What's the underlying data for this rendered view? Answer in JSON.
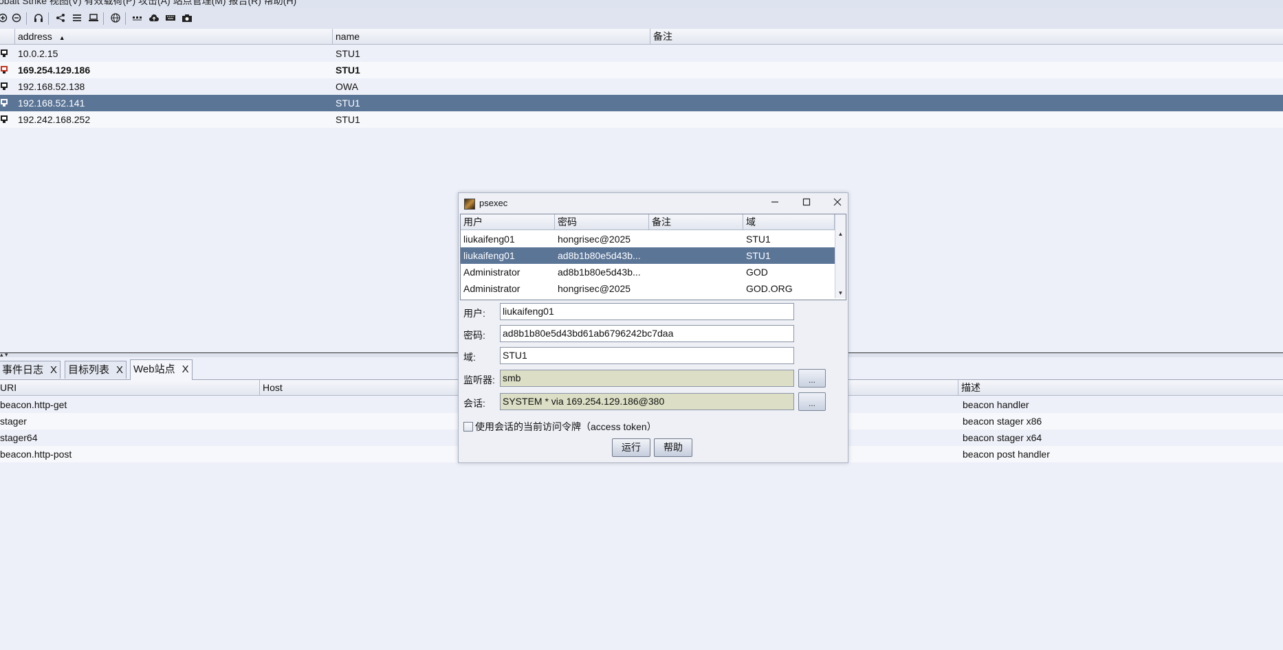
{
  "app": {
    "menu_text": "obalt Strike  视图(V)  有效载荷(P)  攻击(A)  站点管理(M)  报告(R)  帮助(H)"
  },
  "toolbar": {
    "icons": [
      "plus-circle-icon",
      "minus-circle-icon",
      "headphones-icon",
      "share-icon",
      "list-icon",
      "laptop-icon",
      "globe-icon",
      "dots-icon",
      "cloud-icon",
      "keyboard-icon",
      "camera-icon"
    ]
  },
  "targets": {
    "columns": [
      "address",
      "name",
      "备注"
    ],
    "sort_indicator": "▲",
    "rows": [
      {
        "address": "10.0.2.15",
        "name": "STU1",
        "note": ""
      },
      {
        "address": "169.254.129.186",
        "name": "STU1",
        "note": ""
      },
      {
        "address": "192.168.52.138",
        "name": "OWA",
        "note": ""
      },
      {
        "address": "192.168.52.141",
        "name": "STU1",
        "note": ""
      },
      {
        "address": "192.242.168.252",
        "name": "STU1",
        "note": ""
      }
    ]
  },
  "tabs": [
    {
      "label": "事件日志",
      "close": "X"
    },
    {
      "label": "目标列表",
      "close": "X"
    },
    {
      "label": "Web站点",
      "close": "X"
    }
  ],
  "sites": {
    "columns": [
      "URI",
      "Host",
      "描述"
    ],
    "rows": [
      {
        "uri": "beacon.http-get",
        "desc": "beacon handler"
      },
      {
        "uri": "stager",
        "desc": "beacon stager x86"
      },
      {
        "uri": "stager64",
        "desc": "beacon stager x64"
      },
      {
        "uri": "beacon.http-post",
        "desc": "beacon post handler"
      }
    ]
  },
  "dialog": {
    "title": "psexec",
    "cred_columns": [
      "用户",
      "密码",
      "备注",
      "域"
    ],
    "creds": [
      {
        "user": "liukaifeng01",
        "password": "hongrisec@2025",
        "note": "",
        "domain": "STU1"
      },
      {
        "user": "liukaifeng01",
        "password": "ad8b1b80e5d43b...",
        "note": "",
        "domain": "STU1"
      },
      {
        "user": "Administrator",
        "password": "ad8b1b80e5d43b...",
        "note": "",
        "domain": "GOD"
      },
      {
        "user": "Administrator",
        "password": "hongrisec@2025",
        "note": "",
        "domain": "GOD.ORG"
      }
    ],
    "labels": {
      "user": "用户:",
      "password": "密码:",
      "domain": "域:",
      "listener": "监听器:",
      "session": "会话:"
    },
    "values": {
      "user": "liukaifeng01",
      "password": "ad8b1b80e5d43bd61ab6796242bc7daa",
      "domain": "STU1",
      "listener": "smb",
      "session": "SYSTEM * via  169.254.129.186@380"
    },
    "browse": "...",
    "checkbox_label": "使用会话的当前访问令牌（access token）",
    "buttons": {
      "run": "运行",
      "help": "帮助"
    }
  },
  "colors": {
    "selection": "#5b7597",
    "background": "#eef0f9"
  }
}
